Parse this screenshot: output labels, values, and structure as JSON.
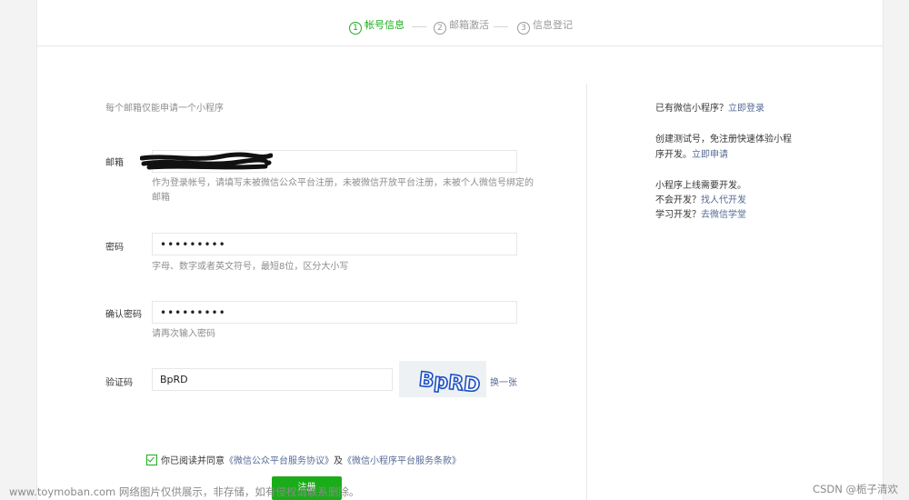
{
  "steps": [
    {
      "num": "1",
      "label": "帐号信息"
    },
    {
      "num": "2",
      "label": "邮箱激活"
    },
    {
      "num": "3",
      "label": "信息登记"
    }
  ],
  "form": {
    "notice": "每个邮箱仅能申请一个小程序",
    "email": {
      "label": "邮箱",
      "tip": "作为登录帐号，请填写未被微信公众平台注册，未被微信开放平台注册，未被个人微信号绑定的邮箱"
    },
    "password": {
      "label": "密码",
      "value": "•••••••••",
      "tip": "字母、数字或者英文符号，最短8位，区分大小写"
    },
    "confirm": {
      "label": "确认密码",
      "value": "•••••••••",
      "tip": "请再次输入密码"
    },
    "captcha": {
      "label": "验证码",
      "value": "BpRD",
      "image_text": "BpRD",
      "refresh": "换一张"
    },
    "agree": {
      "text": "你已阅读并同意",
      "link1": "《微信公众平台服务协议》",
      "and": "及",
      "link2": "《微信小程序平台服务条款》"
    },
    "submit": "注册"
  },
  "sidebar": {
    "has_account": "已有微信小程序？",
    "login_link": "立即登录",
    "test_text": "创建测试号，免注册快速体验小程序开发。",
    "apply_link": "立即申请",
    "dev_text": "小程序上线需要开发。",
    "no_dev": "不会开发？",
    "find_agent": "找人代开发",
    "learn": "学习开发？",
    "academy": "去微信学堂"
  },
  "watermark": "www.toymoban.com 网络图片仅供展示，非存储，如有侵权请联系删除。",
  "csdn": "CSDN @栀子清欢",
  "colors": {
    "accent": "#1aad19",
    "link": "#576b95"
  }
}
